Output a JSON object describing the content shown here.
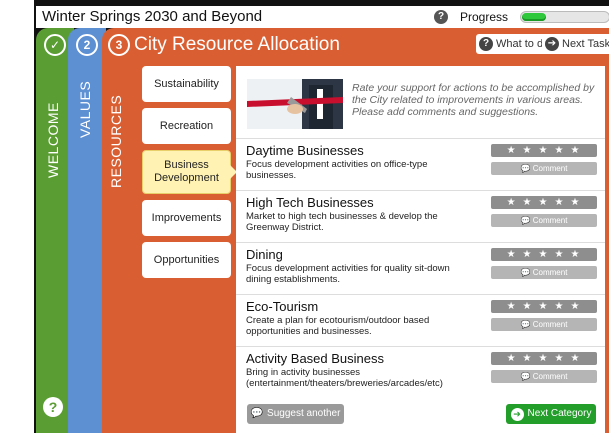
{
  "app": {
    "title": "Winter Springs 2030 and Beyond",
    "progress_label": "Progress",
    "progress_fraction": 0.28
  },
  "tabs": [
    {
      "number": "✓",
      "label": "WELCOME",
      "color": "#5a9e33"
    },
    {
      "number": "2",
      "label": "VALUES",
      "color": "#5d8fd3"
    },
    {
      "number": "3",
      "label": "RESOURCES",
      "color": "#d95f33"
    }
  ],
  "section": {
    "title": "City Resource Allocation",
    "what_to_do": "What to do",
    "next_task": "Next Task"
  },
  "categories": [
    {
      "label": "Sustainability",
      "active": false
    },
    {
      "label": "Recreation",
      "active": false
    },
    {
      "label": "Business Development",
      "active": true
    },
    {
      "label": "Improvements",
      "active": false
    },
    {
      "label": "Opportunities",
      "active": false
    }
  ],
  "intro": {
    "text": "Rate your support for actions to be accomplished by the City related to improvements in various areas. Please add comments and suggestions."
  },
  "items": [
    {
      "title": "Daytime Businesses",
      "desc": "Focus development activities on office-type businesses.",
      "rating_max": 5
    },
    {
      "title": "High Tech Businesses",
      "desc": "Market to high tech businesses & develop the Greenway District.",
      "rating_max": 5
    },
    {
      "title": "Dining",
      "desc": "Focus development activities for quality sit-down dining establishments.",
      "rating_max": 5
    },
    {
      "title": "Eco-Tourism",
      "desc": "Create a plan for ecotourism/outdoor based opportunities and businesses.",
      "rating_max": 5
    },
    {
      "title": "Activity Based Business",
      "desc": "Bring in activity businesses (entertainment/theaters/breweries/arcades/etc)",
      "rating_max": 5
    }
  ],
  "comment_label": "Comment",
  "stars_glyph": "★★★★★",
  "footer": {
    "suggest": "Suggest another",
    "next_category": "Next Category"
  },
  "help_glyph": "?",
  "colors": {
    "welcome": "#5a9e33",
    "values": "#5d8fd3",
    "resources": "#d95f33",
    "progress": "#2fc83c",
    "next_category": "#249e2b"
  }
}
